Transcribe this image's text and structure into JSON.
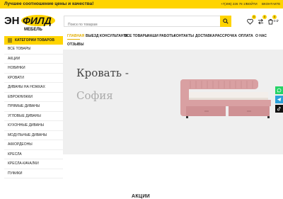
{
  "topbar": {
    "slogan": "Лучшее соотношение цены и качества!",
    "phone": "+7(495) 226 78 17",
    "login": "ВОЙТИ",
    "vk": "ВКОНТАКТЕ"
  },
  "header": {
    "logo_text_top": "ЭН",
    "logo_text_brand": "ФИЛД",
    "logo_text_bottom": "МЕБЕЛЬ",
    "search_placeholder": "Поиск по товарам",
    "wishlist_count": "0",
    "compare_count": "0",
    "cart_count": "0",
    "cart_sum": "0 ₽"
  },
  "categories_button": "КАТЕГОРИИ ТОВАРОВ",
  "nav": {
    "items": [
      "ГЛАВНАЯ",
      "ВЫЕЗД КОНСУЛЬТАНТА",
      "ВСЕ ТОВАРЫ",
      "НАШИ РАБОТЫ",
      "КОНТАКТЫ",
      "ДОСТАВКА",
      "РАССРОЧКА",
      "ОПЛАТА",
      "О НАС",
      "ОТЗЫВЫ"
    ]
  },
  "sidebar": {
    "items": [
      "ВСЕ ТОВАРЫ",
      "АКЦИИ",
      "НОВИНКИ",
      "КРОВАТИ",
      "ДИВАНЫ НА НОЖКАХ",
      "ЕВРОКНИЖКИ",
      "ПРЯМЫЕ ДИВАНЫ",
      "УГЛОВЫЕ ДИВАНЫ",
      "КУХОННЫЕ ДИВАНЫ",
      "МОДУЛЬНЫЕ ДИВАНЫ",
      "АККОРДЕОНЫ",
      "КРЕСЛА",
      "КРЕСЛА-КАЧАЛКИ",
      "ПУФИКИ"
    ]
  },
  "banner": {
    "title_line1": "Кровать -",
    "title_line2": "София",
    "bed_color": "#d9a0a2"
  },
  "colors": {
    "accent": "#ffd400",
    "active_nav": "#e2ad00",
    "whatsapp": "#25d366",
    "telegram": "#2aa1da",
    "tiktok": "#111111"
  },
  "section_title": "АКЦИИ"
}
